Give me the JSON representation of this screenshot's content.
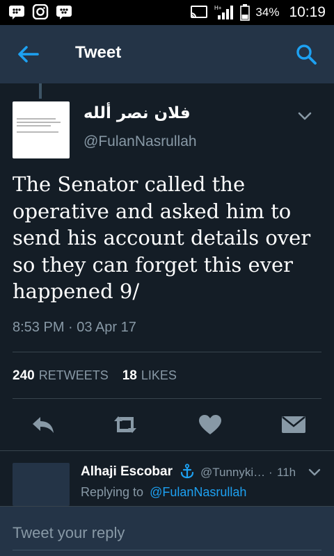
{
  "status_bar": {
    "battery_percent": "34%",
    "time": "10:19",
    "signal_label": "H+"
  },
  "app_bar": {
    "title": "Tweet"
  },
  "tweet": {
    "display_name": "فلان نصر ألله",
    "handle": "@FulanNasrullah",
    "text": "The Senator called the operative and asked him to send his account details over so they can forget this ever happened 9/",
    "timestamp": "8:53 PM · 03 Apr 17",
    "retweets": "240",
    "retweets_label": "RETWEETS",
    "likes": "18",
    "likes_label": "LIKES"
  },
  "reply": {
    "display_name": "Alhaji Escobar",
    "handle": "@Tunnyki…",
    "separator": "·",
    "time": "11h",
    "replying_to_label": "Replying to",
    "replying_to_handle": "@FulanNasrullah"
  },
  "composer": {
    "placeholder": "Tweet your reply"
  },
  "colors": {
    "background": "#141d26",
    "appbar": "#243447",
    "accent": "#1da1f2",
    "muted": "#8899a6"
  }
}
